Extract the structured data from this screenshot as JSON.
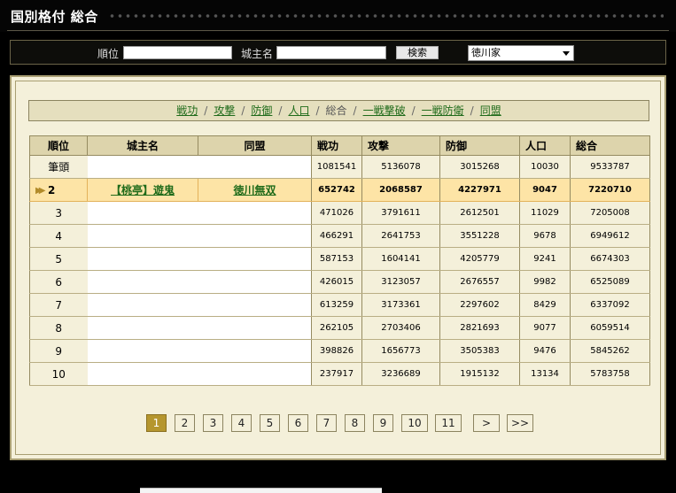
{
  "page": {
    "title": "国別格付 総合"
  },
  "search": {
    "rank_label": "順位",
    "lord_label": "城主名",
    "button_label": "検索",
    "rank_value": "",
    "lord_value": "",
    "country_selected": "徳川家"
  },
  "tabs": [
    {
      "label": "戦功",
      "active": false
    },
    {
      "label": "攻撃",
      "active": false
    },
    {
      "label": "防御",
      "active": false
    },
    {
      "label": "人口",
      "active": false
    },
    {
      "label": "総合",
      "active": true
    },
    {
      "label": "一戦撃破",
      "active": false
    },
    {
      "label": "一戦防衛",
      "active": false
    },
    {
      "label": "同盟",
      "active": false
    }
  ],
  "table": {
    "headers": [
      "順位",
      "城主名",
      "同盟",
      "戦功",
      "攻撃",
      "防御",
      "人口",
      "総合"
    ],
    "rows": [
      {
        "rank": "筆頭",
        "lord": "",
        "alliance": "",
        "senko": "1081541",
        "kougeki": "5136078",
        "bougyo": "3015268",
        "jinkou": "10030",
        "sougou": "9533787"
      },
      {
        "rank": "2",
        "lord": "【桃亭】遊鬼",
        "alliance": "徳川無双",
        "senko": "652742",
        "kougeki": "2068587",
        "bougyo": "4227971",
        "jinkou": "9047",
        "sougou": "7220710",
        "highlight": true
      },
      {
        "rank": "3",
        "lord": "",
        "alliance": "",
        "senko": "471026",
        "kougeki": "3791611",
        "bougyo": "2612501",
        "jinkou": "11029",
        "sougou": "7205008"
      },
      {
        "rank": "4",
        "lord": "",
        "alliance": "",
        "senko": "466291",
        "kougeki": "2641753",
        "bougyo": "3551228",
        "jinkou": "9678",
        "sougou": "6949612"
      },
      {
        "rank": "5",
        "lord": "",
        "alliance": "",
        "senko": "587153",
        "kougeki": "1604141",
        "bougyo": "4205779",
        "jinkou": "9241",
        "sougou": "6674303"
      },
      {
        "rank": "6",
        "lord": "",
        "alliance": "",
        "senko": "426015",
        "kougeki": "3123057",
        "bougyo": "2676557",
        "jinkou": "9982",
        "sougou": "6525089"
      },
      {
        "rank": "7",
        "lord": "",
        "alliance": "",
        "senko": "613259",
        "kougeki": "3173361",
        "bougyo": "2297602",
        "jinkou": "8429",
        "sougou": "6337092"
      },
      {
        "rank": "8",
        "lord": "",
        "alliance": "",
        "senko": "262105",
        "kougeki": "2703406",
        "bougyo": "2821693",
        "jinkou": "9077",
        "sougou": "6059514"
      },
      {
        "rank": "9",
        "lord": "",
        "alliance": "",
        "senko": "398826",
        "kougeki": "1656773",
        "bougyo": "3505383",
        "jinkou": "9476",
        "sougou": "5845262"
      },
      {
        "rank": "10",
        "lord": "",
        "alliance": "",
        "senko": "237917",
        "kougeki": "3236689",
        "bougyo": "1915132",
        "jinkou": "13134",
        "sougou": "5783758"
      }
    ]
  },
  "pagination": {
    "pages": [
      "1",
      "2",
      "3",
      "4",
      "5",
      "6",
      "7",
      "8",
      "9",
      "10",
      "11"
    ],
    "current": "1",
    "next_label": ">",
    "last_label": ">>"
  },
  "colors": {
    "background": "#000000",
    "panel": "#f4f0da",
    "header": "#ddd4ac",
    "highlight": "#fde4a6",
    "link": "#1f6b1a",
    "active_page": "#b5962e"
  }
}
